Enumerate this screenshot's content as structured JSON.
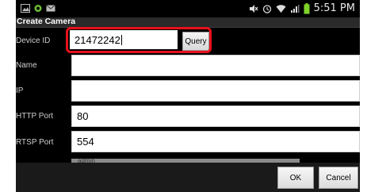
{
  "statusbar": {
    "time": "5:51 PM",
    "left_icons": [
      "image-icon",
      "sync-icon",
      "mail-icon"
    ],
    "right_icons": [
      "mute-icon",
      "alarm-icon",
      "wifi-icon",
      "signal-icon",
      "battery-icon"
    ]
  },
  "dialog": {
    "title": "Create Camera"
  },
  "form": {
    "device_id": {
      "label": "Device ID",
      "value": "21472242"
    },
    "query_label": "Query",
    "name": {
      "label": "Name",
      "value": ""
    },
    "ip": {
      "label": "IP",
      "value": ""
    },
    "http_port": {
      "label": "HTTP Port",
      "value": "80"
    },
    "rtsp_port": {
      "label": "RTSP Port",
      "value": "554"
    },
    "user_partial": "admin"
  },
  "buttons": {
    "ok": "OK",
    "cancel": "Cancel"
  },
  "colors": {
    "highlight": "#e8101a",
    "battery": "#7fd42a"
  }
}
